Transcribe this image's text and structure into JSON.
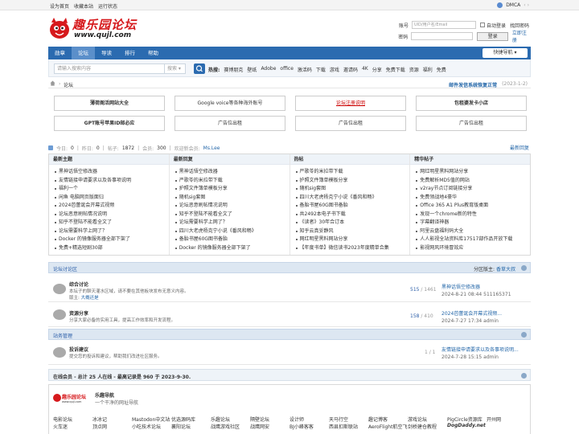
{
  "topbar": {
    "links": [
      "设为首页",
      "收藏本站",
      "运行状态"
    ],
    "dmca": "DMCA",
    "arrows": "‹ ›"
  },
  "logo": {
    "main": "趣乐园论坛",
    "sub": "www.qujl.com",
    "color": "#d6191c"
  },
  "login": {
    "account_label": "账号",
    "account_placeholder": "UID/用户名/Email",
    "password_label": "密码",
    "remember": "自动登录",
    "forgot": "找回密码",
    "submit": "登录",
    "register": "立即注册"
  },
  "nav": {
    "items": [
      "勋章",
      "论坛",
      "导读",
      "排行",
      "帮助"
    ],
    "active": 1,
    "quick": "快捷导航 ▾",
    "color": "#2b6bb0"
  },
  "search": {
    "placeholder": "请输入搜索内容",
    "type": "搜索 ▾",
    "hot_label": "热搜:",
    "hot": [
      "赛博朋克",
      "壁纸",
      "Adobe",
      "office",
      "激活码",
      "下载",
      "游戏",
      "邀请码",
      "4K",
      "分享",
      "免费下载",
      "资源",
      "福利",
      "免费"
    ]
  },
  "crumb": {
    "current": "论坛",
    "notice_title": "邮件发信系统恢复正常",
    "notice_date": "(2023-1-2)"
  },
  "ads": [
    {
      "text": "薄荷阁活网站大全",
      "style": "b"
    },
    {
      "text": "Google voice等各种海外账号",
      "style": ""
    },
    {
      "text": "论坛注册说明",
      "style": "red"
    },
    {
      "text": "包租婆发卡小店",
      "style": "b"
    },
    {
      "text": "GPT账号苹果ID邮必应",
      "style": "b"
    },
    {
      "text": "广告位出租",
      "style": ""
    },
    {
      "text": "广告位出租",
      "style": ""
    },
    {
      "text": "广告位出租",
      "style": ""
    }
  ],
  "stats": {
    "today_label": "今日:",
    "today": "0",
    "yesterday_label": "昨日:",
    "yesterday": "0",
    "posts_label": "帖子:",
    "posts": "1872",
    "members_label": "会员:",
    "members": "300",
    "welcome_label": "欢迎新会员:",
    "newest": "Ms.Lee",
    "latest_reply": "最新回复"
  },
  "lists": [
    {
      "title": "最新主题",
      "items": [
        "黑神话悟空修改器",
        "友情链接申请要求以及各事项说明",
        "福利一个",
        "闲鱼 电脑网页版面归",
        "2024芭蕾诞会开幕式视频",
        "论坛恶意刷帖情况说明",
        "知乎不登陆不能看全文了",
        "论坛需要科学上网了？",
        "Docker 的镜像服务器全部下架了",
        "免费+精选短剧30部"
      ]
    },
    {
      "title": "最新回复",
      "items": [
        "黑神话悟空修改器",
        "严歌苓的米拉带下载",
        "护照文件簿单模板分享",
        "随机sig套图",
        "论坛恶意刷帖情况说明",
        "知乎不登陆不能看全文了",
        "论坛需要科学上网了？",
        "四川大老虎杨克宁小说《番风和畅》",
        "备胎书屋60G图书备胎",
        "Docker 的镜像服务器全部下架了"
      ]
    },
    {
      "title": "热帖",
      "items": [
        "严歌苓的米拉带下载",
        "护照文件簿单模板分享",
        "随机sig套图",
        "四川大老虎杨克宁小说《番风和畅》",
        "备胎书屋60G图书备胎",
        "共2492本电子书下载",
        "《读者》30年合订本",
        "知乎云真妥静风",
        "网红明星黑料网站分享",
        "【年度书单】微信读书2023年度精单合集"
      ]
    },
    {
      "title": "精华帖子",
      "items": [
        "网红明星黑料网站分享",
        "免费解析MD5值的网站",
        "v2ray节点订阅链接分享",
        "免费领战地4豪华",
        "Office 365 A1 Plus教育版桌面",
        "发现一个chrome新的特性",
        "字幕翻译神器",
        "阿里云盘福利码大全",
        "人人影视全站资料库17517部作品开放下载",
        "影视网风环境冒效应"
      ]
    }
  ],
  "sections": [
    {
      "title": "论坛讨论区",
      "mod_label": "分区版主:",
      "mod": "香草大叔"
    },
    {
      "title": "站务管理"
    }
  ],
  "forums": [
    {
      "name": "综合讨论",
      "desc": "本坛子的聊天灌水区域，请不要在其他板块发布无意义内容。",
      "mod_label": "版主:",
      "mod": "大概还是",
      "threads": "515",
      "posts": "1461",
      "last_title": "黑神话悟空修改器",
      "last_info": "2024-8-21 08:44 511165371"
    },
    {
      "name": "资源分享",
      "desc": "分享大家必备的实用工具，提高工作效率和开发流程。",
      "mod_label": "",
      "mod": "",
      "threads": "158",
      "posts": "410",
      "last_title": "2024芭蕾诞会开幕式视频...",
      "last_info": "2024-7-27 17:34 admin"
    },
    {
      "name": "投诉建议",
      "desc": "提交您的投诉和建议，帮助我们改进社区服务。",
      "mod_label": "",
      "mod": "",
      "threads": "1",
      "posts": "1",
      "last_title": "友情链接申请要求以及各事项说明...",
      "last_info": "2024-7-28 15:15 admin"
    }
  ],
  "online": {
    "text": "在线会员 - 总计 25 人在线 - 最高记录是 960 于 2023-9-30."
  },
  "footer_nav": {
    "title": "乐趣导航",
    "subtitle": "一个干净的网址导航",
    "links": [
      [
        "电影论坛",
        "冰冰记",
        "Mastodon中文站",
        "优选源码库",
        "乐趣论坛",
        "隔壁论坛",
        "设计师",
        "天马行空",
        "趣记博客",
        "游戏论坛",
        "PigCircle资源库",
        "开州网"
      ],
      [
        "火车迷",
        "顶点网",
        "小吃技术论坛",
        "襄阳论坛",
        "战鹰游戏社区",
        "战鹰网安",
        "BJ小峰客客",
        "西县扣斯联站",
        "AeroFlight航空飞",
        "剑桥建仓教程",
        "DogDaddy.net"
      ]
    ]
  }
}
